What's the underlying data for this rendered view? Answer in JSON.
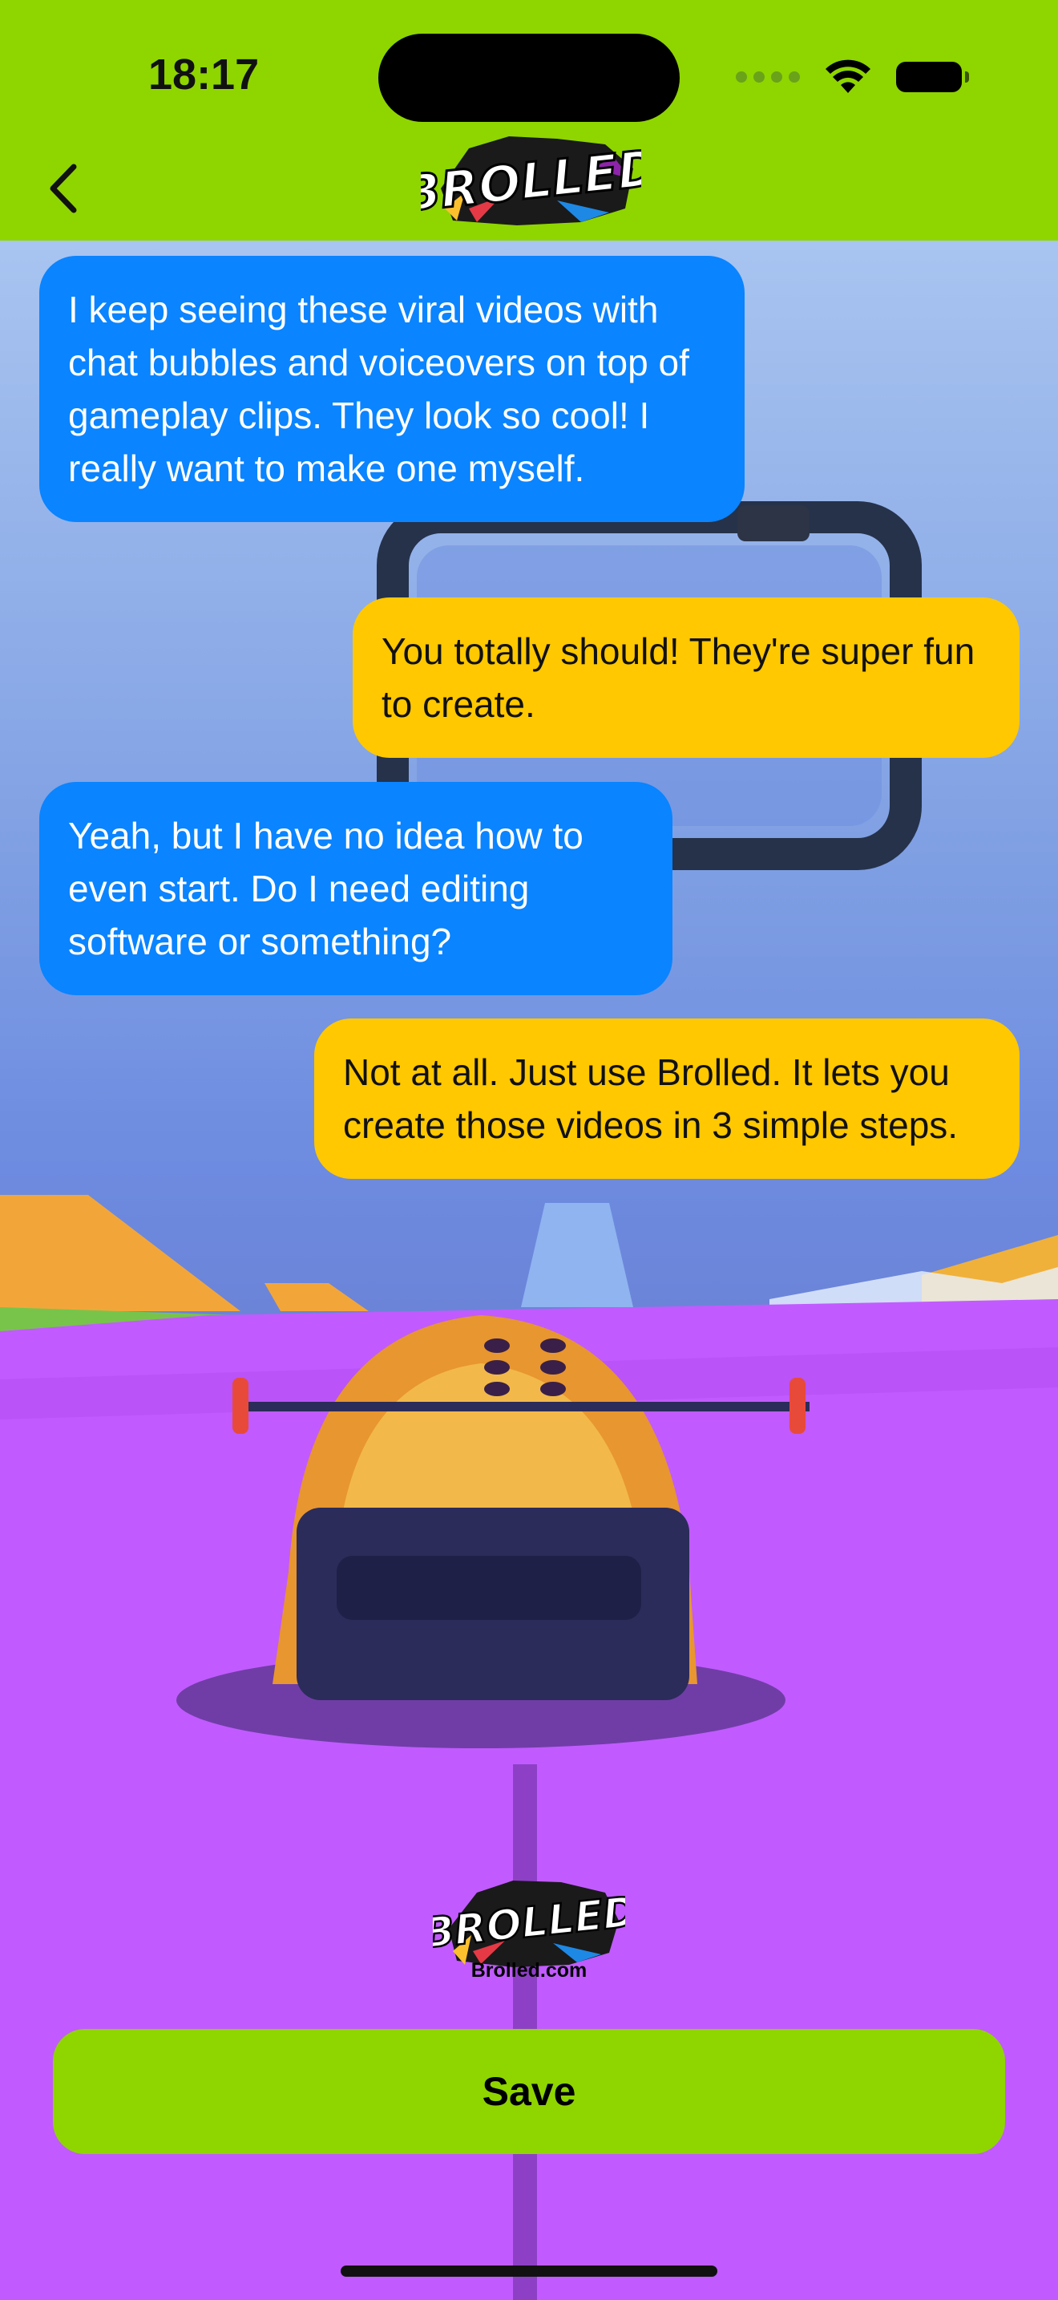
{
  "status_bar": {
    "time": "18:17",
    "wifi_icon": "wifi-icon",
    "battery_icon": "battery-icon"
  },
  "header": {
    "back_icon": "chevron-left-icon",
    "logo_text": "BROLLED",
    "background_color": "#8fd500"
  },
  "messages": [
    {
      "side": "left",
      "text": "I keep seeing these viral videos with chat bubbles and voiceovers on top of gameplay clips. They look so cool! I really want to make one myself."
    },
    {
      "side": "right",
      "text": "You totally should! They're super fun to create."
    },
    {
      "side": "left",
      "text": "Yeah, but I have no idea how to even start. Do I need editing software or something?"
    },
    {
      "side": "right",
      "text": "Not at all. Just use Brolled. It lets you create those videos in 3 simple steps."
    }
  ],
  "watermark": {
    "logo_text": "BROLLED",
    "url": "Brolled.com"
  },
  "save_button": {
    "label": "Save"
  },
  "colors": {
    "left_bubble": "#0a84ff",
    "right_bubble": "#ffc800",
    "accent": "#8fd500"
  }
}
